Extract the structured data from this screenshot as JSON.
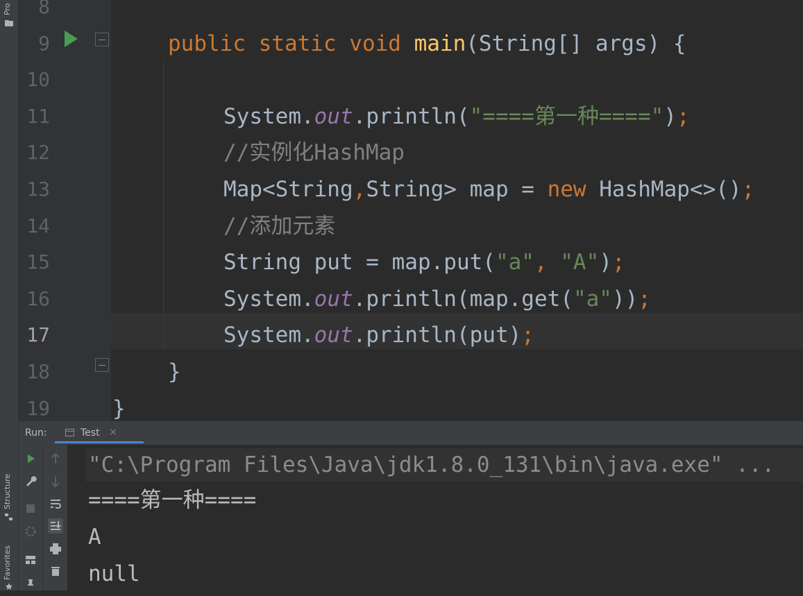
{
  "side_panel": {
    "project_label": "Pro",
    "structure_label": "Structure",
    "favorites_label": "Favorites"
  },
  "editor": {
    "lines": [
      {
        "num": "8"
      },
      {
        "num": "9",
        "tokens": [
          [
            "kw",
            "public static void "
          ],
          [
            "fn",
            "main"
          ],
          [
            "",
            "(String[] args) {"
          ]
        ]
      },
      {
        "num": "10"
      },
      {
        "num": "11",
        "tokens": [
          [
            "",
            "System."
          ],
          [
            "fld",
            "out"
          ],
          [
            "",
            ".println("
          ],
          [
            "st",
            "\"====第一种====\""
          ],
          [
            "",
            ")"
          ],
          [
            "kw",
            ";"
          ]
        ]
      },
      {
        "num": "12",
        "tokens": [
          [
            "cm",
            "//实例化HashMap"
          ]
        ]
      },
      {
        "num": "13",
        "tokens": [
          [
            "",
            "Map<String"
          ],
          [
            "kw",
            ","
          ],
          [
            "",
            "String> map = "
          ],
          [
            "kw",
            "new "
          ],
          [
            "",
            "HashMap<>()"
          ],
          [
            "kw",
            ";"
          ]
        ]
      },
      {
        "num": "14",
        "tokens": [
          [
            "cm",
            "//添加元素"
          ]
        ]
      },
      {
        "num": "15",
        "tokens": [
          [
            "",
            "String put = map.put("
          ],
          [
            "st",
            "\"a\""
          ],
          [
            "kw",
            ", "
          ],
          [
            "st",
            "\"A\""
          ],
          [
            "",
            ")"
          ],
          [
            "kw",
            ";"
          ]
        ]
      },
      {
        "num": "16",
        "tokens": [
          [
            "",
            "System."
          ],
          [
            "fld",
            "out"
          ],
          [
            "",
            ".println(map.get("
          ],
          [
            "st",
            "\"a\""
          ],
          [
            "",
            "))"
          ],
          [
            "kw",
            ";"
          ]
        ]
      },
      {
        "num": "17",
        "tokens": [
          [
            "",
            "System."
          ],
          [
            "fld",
            "out"
          ],
          [
            "",
            ".println(put)"
          ],
          [
            "kw",
            ";"
          ]
        ]
      },
      {
        "num": "18",
        "tokens": [
          [
            "",
            "}"
          ]
        ]
      },
      {
        "num": "19",
        "tokens": [
          [
            "",
            "}"
          ]
        ]
      }
    ]
  },
  "run_panel": {
    "label": "Run:",
    "tab_title": "Test",
    "tab_close": "×",
    "command": "\"C:\\Program Files\\Java\\jdk1.8.0_131\\bin\\java.exe\" ...",
    "output": [
      "====第一种====",
      "A",
      "null"
    ]
  },
  "colors": {
    "keyword": "#cc7832",
    "method": "#ffc66d",
    "string": "#6a8759",
    "field": "#9876aa",
    "comment": "#808080",
    "default": "#a9b7c6",
    "run_icon": "#499c54"
  }
}
